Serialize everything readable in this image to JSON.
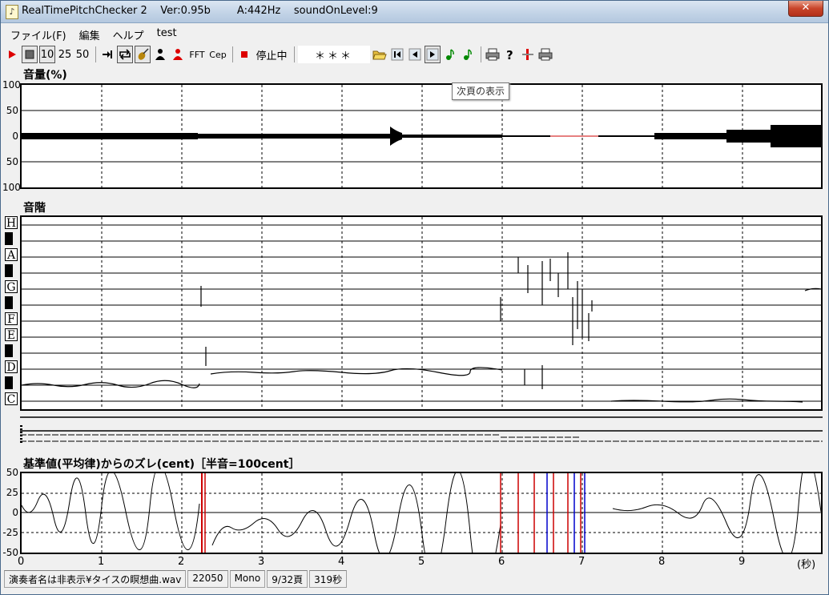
{
  "window": {
    "title": "RealTimePitchChecker 2    Ver:0.95b        A:442Hz    soundOnLevel:9",
    "close_label": "✕"
  },
  "menu": [
    "ファイル(F)",
    "編集",
    "ヘルプ",
    "test"
  ],
  "toolbar": {
    "play_icon": "play-icon",
    "stop_icon": "stop-icon",
    "speed_10": "10",
    "speed_25": "25",
    "speed_50": "50",
    "fft_label": "FFT",
    "cep_label": "Cep",
    "status_text": "停止中",
    "stars": "＊＊＊"
  },
  "tooltip": "次頁の表示",
  "panels": {
    "volume": {
      "title": "音量(%)",
      "y_ticks": [
        "100",
        "50",
        "0",
        "50",
        "100"
      ]
    },
    "scale": {
      "title": "音階",
      "notes": [
        "H",
        "A",
        "G",
        "F",
        "E",
        "D",
        "C"
      ]
    },
    "cent": {
      "title": "基準値(平均律)からのズレ(cent)［半音=100cent］",
      "y_ticks": [
        "50",
        "25",
        "0",
        "-25",
        "-50"
      ]
    }
  },
  "x_axis": {
    "ticks": [
      "0",
      "1",
      "2",
      "3",
      "4",
      "5",
      "6",
      "7",
      "8",
      "9"
    ],
    "unit": "(秒)"
  },
  "statusbar": [
    "演奏者名は非表示¥タイスの瞑想曲.wav",
    "22050",
    "Mono",
    "9/32頁",
    "319秒"
  ],
  "colors": {
    "accent_red": "#cc0000",
    "trace": "#000000",
    "blue_trace": "#0000cc"
  }
}
